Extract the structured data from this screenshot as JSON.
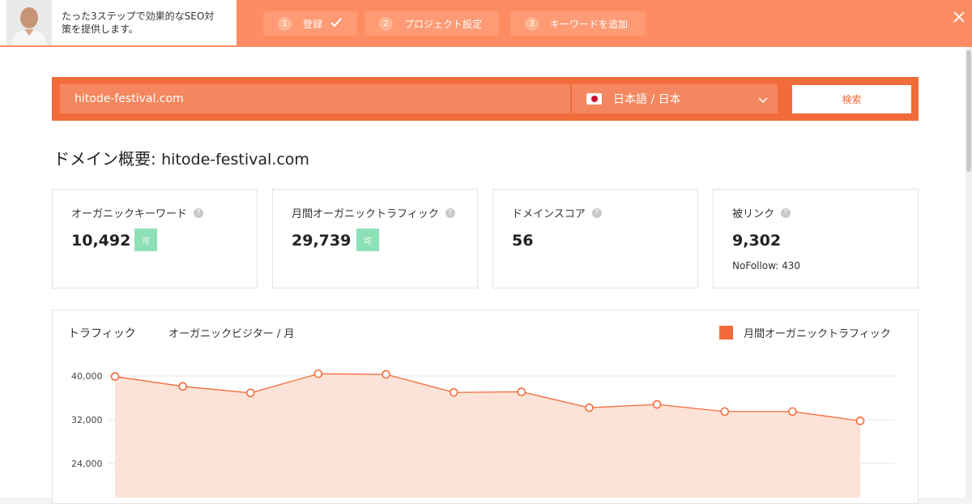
{
  "onboarding": {
    "intro_text": "たった3ステップで効果的なSEO対策を提供します。",
    "steps": [
      {
        "num": "1",
        "label": "登録",
        "done": true
      },
      {
        "num": "2",
        "label": "プロジェクト設定",
        "done": false
      },
      {
        "num": "3",
        "label": "キーワードを追加",
        "done": false
      }
    ]
  },
  "search": {
    "domain_value": "hitode-festival.com",
    "language": "日本語 / 日本",
    "button_label": "検索"
  },
  "overview": {
    "title_prefix": "ドメイン概要:",
    "title_domain": "hitode-festival.com"
  },
  "cards": [
    {
      "label": "オーガニックキーワード",
      "value": "10,492",
      "badge": "可"
    },
    {
      "label": "月間オーガニックトラフィック",
      "value": "29,739",
      "badge": "可"
    },
    {
      "label": "ドメインスコア",
      "value": "56"
    },
    {
      "label": "被リンク",
      "value": "9,302",
      "sub": "NoFollow: 430"
    }
  ],
  "chart": {
    "title": "トラフィック",
    "subtitle": "オーガニックビジター / 月",
    "legend": "月間オーガニックトラフィック"
  },
  "colors": {
    "accent": "#f26b3a",
    "topbar": "#fe8c62",
    "badge": "#8ee0b6",
    "area_fill": "#fde2d7"
  },
  "chart_data": {
    "type": "area",
    "series": [
      {
        "name": "月間オーガニックトラフィック",
        "values": [
          39900,
          38100,
          36900,
          40400,
          40300,
          37000,
          37100,
          34200,
          34800,
          33500,
          33500,
          31800
        ]
      }
    ],
    "y_ticks": [
      40000,
      32000,
      24000
    ],
    "y_tick_labels": [
      "40,000",
      "32,000",
      "24,000"
    ],
    "grid": true,
    "legend_position": "top-right"
  }
}
